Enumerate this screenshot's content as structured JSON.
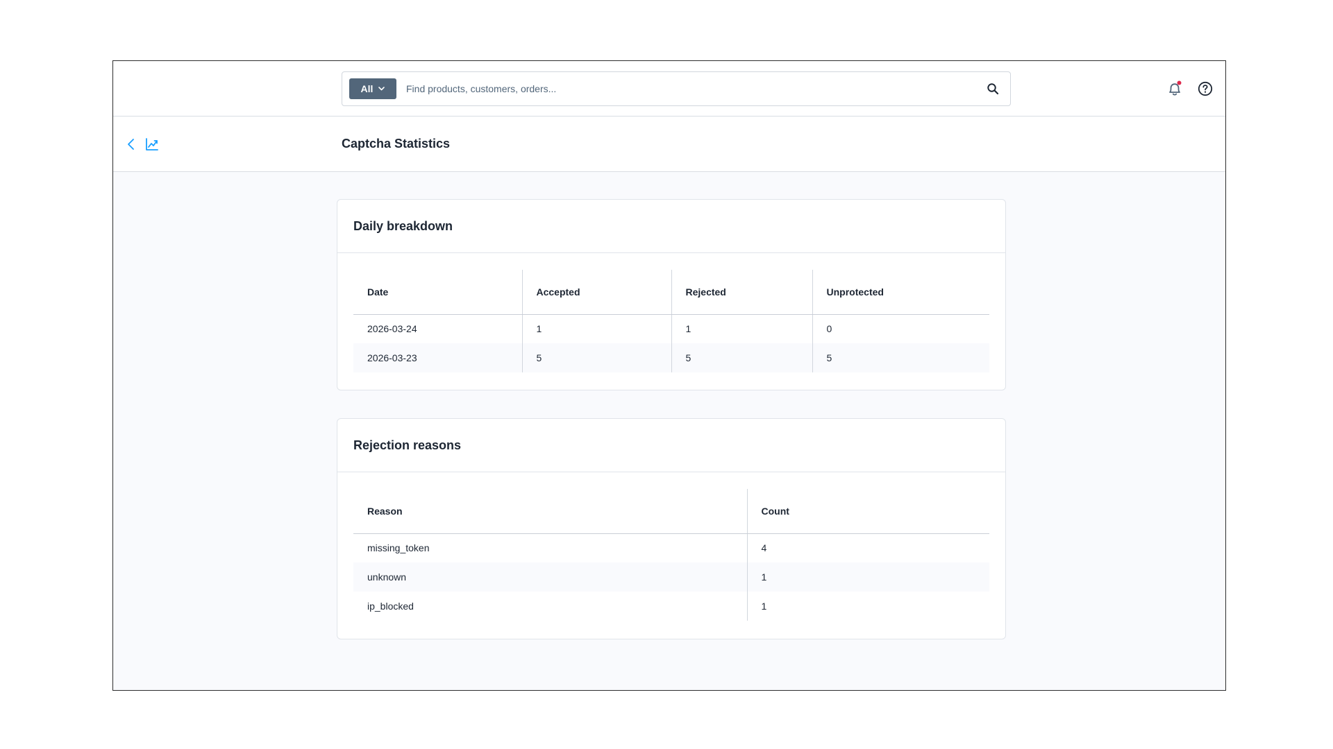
{
  "search": {
    "type_label": "All",
    "placeholder": "Find products, customers, orders..."
  },
  "header": {
    "title": "Captcha Statistics"
  },
  "daily_breakdown": {
    "title": "Daily breakdown",
    "columns": [
      "Date",
      "Accepted",
      "Rejected",
      "Unprotected"
    ],
    "rows": [
      [
        "2026-03-24",
        "1",
        "1",
        "0"
      ],
      [
        "2026-03-23",
        "5",
        "5",
        "5"
      ]
    ]
  },
  "rejection_reasons": {
    "title": "Rejection reasons",
    "columns": [
      "Reason",
      "Count"
    ],
    "rows": [
      [
        "missing_token",
        "4"
      ],
      [
        "unknown",
        "1"
      ],
      [
        "ip_blocked",
        "1"
      ]
    ]
  },
  "colors": {
    "accent": "#189eff",
    "notification_dot": "#de294c",
    "search_type_bg": "#52667a"
  },
  "icons": {
    "search": "search-icon",
    "notifications": "bell-icon",
    "help": "help-icon",
    "back": "chevron-left-icon",
    "statistics": "chart-line-icon"
  }
}
